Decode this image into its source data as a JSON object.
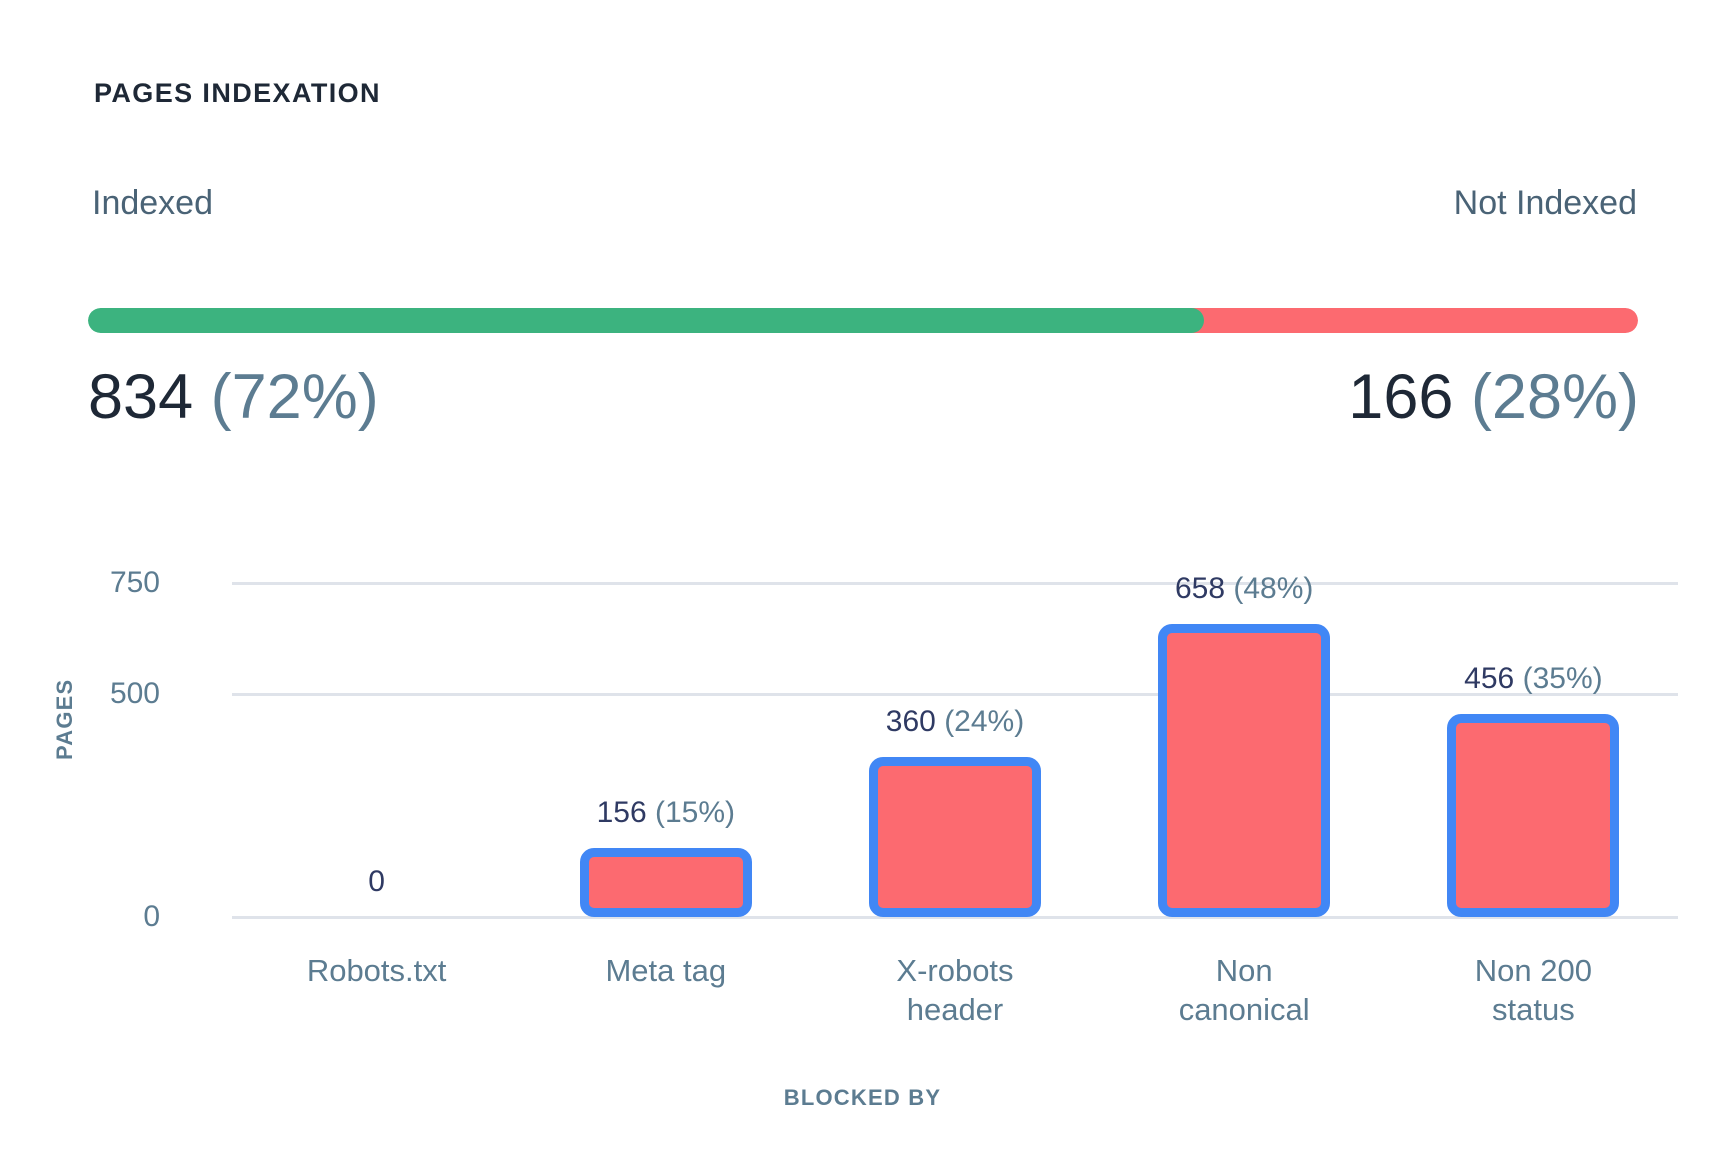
{
  "header": {
    "title": "PAGES INDEXATION"
  },
  "summary": {
    "indexed_label": "Indexed",
    "not_indexed_label": "Not Indexed",
    "indexed_count": "834",
    "indexed_pct_label": "(72%)",
    "not_indexed_count": "166",
    "not_indexed_pct_label": "(28%)",
    "indexed_pct": 72,
    "not_indexed_pct": 28,
    "indexed_color": "#3cb37f",
    "not_indexed_color": "#fc6a70"
  },
  "chart_data": {
    "type": "bar",
    "title": "PAGES INDEXATION",
    "xlabel": "BLOCKED BY",
    "ylabel": "PAGES",
    "categories": [
      "Robots.txt",
      "Meta tag",
      "X-robots header",
      "Non canonical",
      "Non 200 status"
    ],
    "values": [
      0,
      156,
      360,
      658,
      456
    ],
    "value_labels": [
      "0",
      "156",
      "360",
      "658",
      "456"
    ],
    "percent_labels": [
      "",
      "(15%)",
      "(24%)",
      "(48%)",
      "(35%)"
    ],
    "yticks": [
      "750",
      "500",
      "0"
    ],
    "ytick_values": [
      750,
      500,
      0
    ],
    "ylim": [
      0,
      750
    ],
    "grid": true,
    "legend": "none",
    "bar_fill_color": "#fc6a70",
    "bar_border_color": "#4187f5",
    "gridline_color": "#dfe3ea",
    "label_color": "#5c7c91"
  },
  "xlabels_lines": [
    [
      "Robots.txt"
    ],
    [
      "Meta tag"
    ],
    [
      "X-robots",
      "header"
    ],
    [
      "Non",
      "canonical"
    ],
    [
      "Non 200",
      "status"
    ]
  ]
}
